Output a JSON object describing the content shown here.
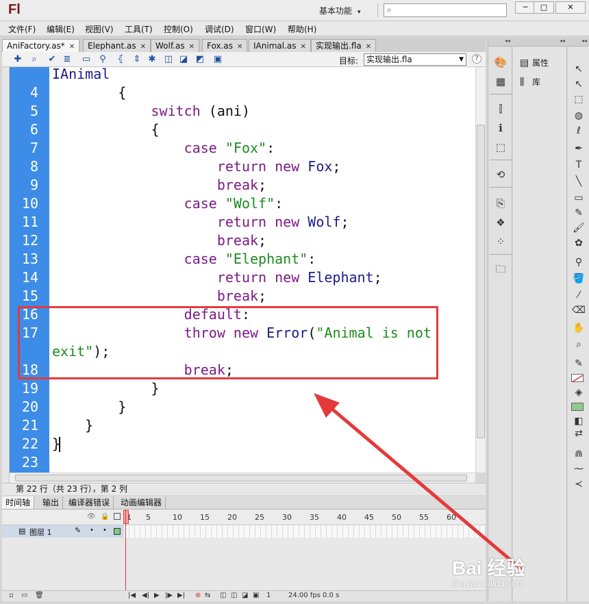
{
  "app": {
    "logo": "Fl",
    "workspace": "基本功能",
    "search_placeholder": ""
  },
  "window": {
    "minimize": "─",
    "maximize": "□",
    "close": "✕"
  },
  "menu": [
    "文件(F)",
    "编辑(E)",
    "视图(V)",
    "工具(T)",
    "控制(O)",
    "调试(D)",
    "窗口(W)",
    "帮助(H)"
  ],
  "tabs": [
    {
      "label": "AniFactory.as*",
      "active": true
    },
    {
      "label": "Elephant.as",
      "active": false
    },
    {
      "label": "Wolf.as",
      "active": false
    },
    {
      "label": "Fox.as",
      "active": false
    },
    {
      "label": "IAnimal.as",
      "active": false
    },
    {
      "label": "实现输出.fla",
      "active": false
    }
  ],
  "editor_toolbar": {
    "target_label": "目标:",
    "target_value": "实现输出.fla",
    "icons": [
      "add-script-icon",
      "find-icon",
      "check-syntax-icon",
      "auto-format-icon",
      "code-hint-icon",
      "debug-options-icon",
      "collapse-between-icon",
      "collapse-selection-icon",
      "expand-all-icon",
      "apply-block-comment-icon",
      "apply-line-comment-icon",
      "remove-comment-icon",
      "show-toolbox-icon"
    ]
  },
  "code": {
    "top_fragment": "IAnimal",
    "lines": [
      {
        "n": "4",
        "text": "        {"
      },
      {
        "n": "5",
        "text": "            switch (ani)"
      },
      {
        "n": "6",
        "text": "            {"
      },
      {
        "n": "7",
        "text": "                case \"Fox\":"
      },
      {
        "n": "8",
        "text": "                    return new Fox;"
      },
      {
        "n": "9",
        "text": "                    break;"
      },
      {
        "n": "10",
        "text": "                case \"Wolf\":"
      },
      {
        "n": "11",
        "text": "                    return new Wolf;"
      },
      {
        "n": "12",
        "text": "                    break;"
      },
      {
        "n": "13",
        "text": "                case \"Elephant\":"
      },
      {
        "n": "14",
        "text": "                    return new Elephant;"
      },
      {
        "n": "15",
        "text": "                    break;"
      },
      {
        "n": "16",
        "text": "                default:"
      },
      {
        "n": "17",
        "text": "                throw new Error(\"Animal is not"
      },
      {
        "n": "",
        "text": "exit\");"
      },
      {
        "n": "18",
        "text": "                break;"
      },
      {
        "n": "19",
        "text": "            }"
      },
      {
        "n": "20",
        "text": "        }"
      },
      {
        "n": "21",
        "text": "    }"
      },
      {
        "n": "22",
        "text": "}"
      },
      {
        "n": "23",
        "text": ""
      }
    ]
  },
  "status": "第 22 行（共 23 行），第 2 列",
  "bottom_tabs": [
    "时间轴",
    "输出",
    "编译器错误",
    "动画编辑器"
  ],
  "timeline": {
    "frame_numbers": [
      "1",
      "5",
      "10",
      "15",
      "20",
      "25",
      "30",
      "35",
      "40",
      "45",
      "50",
      "55",
      "60"
    ],
    "layer_name": "图层 1",
    "current_frame": "1",
    "fps": "24.00 fps",
    "time": "0.0 s"
  },
  "right_panel": {
    "properties": "属性",
    "library": "库"
  },
  "watermark": {
    "main": "Bai  经验",
    "sub": "jingyan.baidu.com"
  },
  "colors": {
    "gutter": "#3d8ce8",
    "keyword": "#7b1a86",
    "string": "#1d8a1d",
    "highlight": "#e53a3a"
  }
}
